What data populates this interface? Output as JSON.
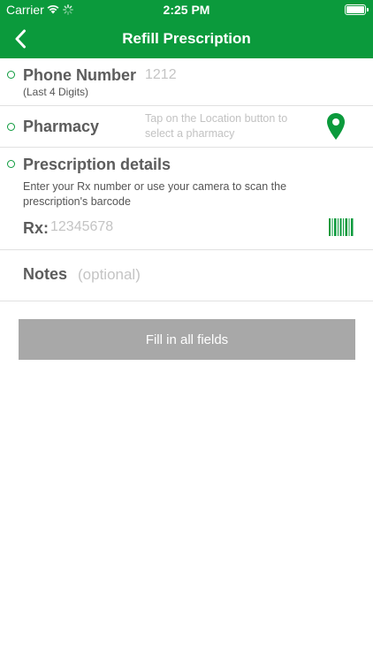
{
  "status_bar": {
    "carrier": "Carrier",
    "time": "2:25 PM"
  },
  "nav": {
    "title": "Refill Prescription",
    "back_icon": "chevron-left-icon"
  },
  "phone": {
    "label": "Phone Number",
    "sublabel": "(Last 4 Digits)",
    "value": "1212"
  },
  "pharmacy": {
    "label": "Pharmacy",
    "hint": "Tap on the Location button to select a pharmacy",
    "icon": "location-pin-icon"
  },
  "prescription": {
    "label": "Prescription details",
    "description": "Enter your Rx number or use your camera to scan the prescription's barcode",
    "rx_label": "Rx:",
    "rx_placeholder": "12345678",
    "scan_icon": "barcode-icon"
  },
  "notes": {
    "label": "Notes",
    "placeholder": "(optional)"
  },
  "submit": {
    "label": "Fill in all fields"
  },
  "colors": {
    "brand_green": "#0b9a3c",
    "disabled_button": "#a8a8a8"
  }
}
